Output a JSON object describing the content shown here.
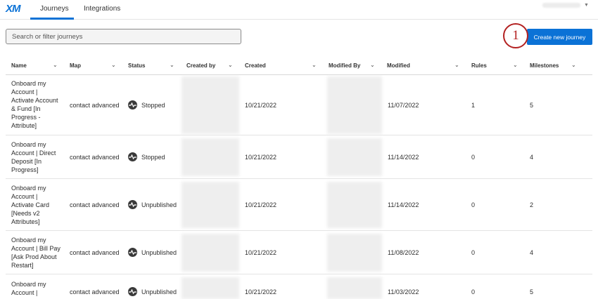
{
  "app": {
    "logo": "XM"
  },
  "nav": {
    "tabs": [
      "Journeys",
      "Integrations"
    ],
    "active_tab": "Journeys"
  },
  "search": {
    "placeholder": "Search or filter journeys"
  },
  "actions": {
    "create_label": "Create new journey"
  },
  "annotation": {
    "step": "1",
    "color": "#b32121"
  },
  "colors": {
    "accent": "#0b72d6"
  },
  "table": {
    "columns": [
      "Name",
      "Map",
      "Status",
      "Created by",
      "Created",
      "Modified By",
      "Modified",
      "Rules",
      "Milestones"
    ],
    "rows": [
      {
        "name_lines": [
          "Onboard my",
          "Account |",
          "Activate Account",
          "& Fund [In",
          "Progress -",
          "Attribute]"
        ],
        "map": "contact advanced",
        "status": "Stopped",
        "created": "10/21/2022",
        "modified": "11/07/2022",
        "rules": "1",
        "milestones": "5"
      },
      {
        "name_lines": [
          "Onboard my",
          "Account | Direct",
          "Deposit [In",
          "Progress]"
        ],
        "map": "contact advanced",
        "status": "Stopped",
        "created": "10/21/2022",
        "modified": "11/14/2022",
        "rules": "0",
        "milestones": "4"
      },
      {
        "name_lines": [
          "Onboard my",
          "Account |",
          "Activate Card",
          "[Needs v2",
          "Attributes]"
        ],
        "map": "contact advanced",
        "status": "Unpublished",
        "created": "10/21/2022",
        "modified": "11/14/2022",
        "rules": "0",
        "milestones": "2"
      },
      {
        "name_lines": [
          "Onboard my",
          "Account | Bill Pay",
          "[Ask Prod About",
          "Restart]"
        ],
        "map": "contact advanced",
        "status": "Unpublished",
        "created": "10/21/2022",
        "modified": "11/08/2022",
        "rules": "0",
        "milestones": "4"
      },
      {
        "name_lines": [
          "Onboard my",
          "Account |"
        ],
        "map": "contact advanced",
        "status": "Unpublished",
        "created": "10/21/2022",
        "modified": "11/03/2022",
        "rules": "0",
        "milestones": "5"
      }
    ]
  },
  "icons": {
    "status": "pulse-icon",
    "column_sort": "chevron-down-icon",
    "user_menu": "caret-down-icon"
  }
}
